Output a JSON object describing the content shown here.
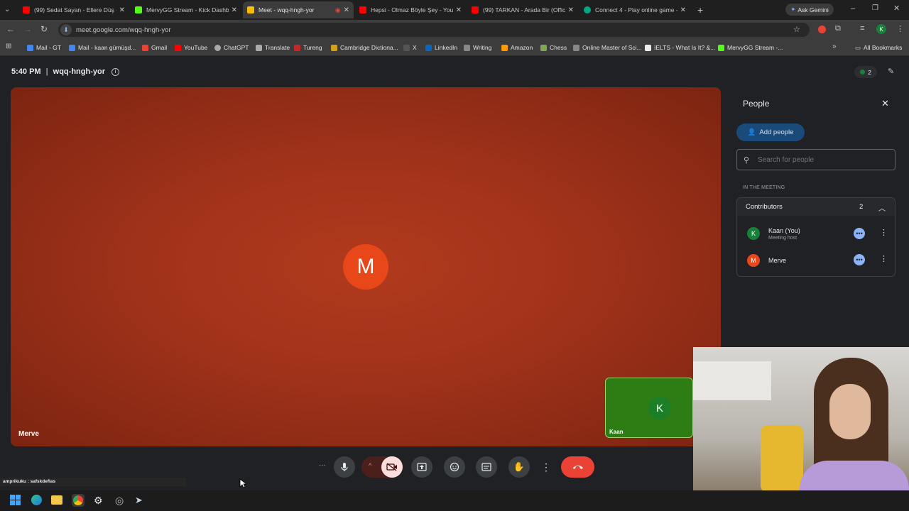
{
  "tabs": [
    {
      "title": "(99) Sedat Sayan - Ellere Düş - Y",
      "color": "#ff0000"
    },
    {
      "title": "MervyGG Stream - Kick Dashbo",
      "color": "#53fc18"
    },
    {
      "title": "Meet - wqq-hngh-yor",
      "color": "#fbbc04"
    },
    {
      "title": "Hepsi - Olmaz Böyle Şey - YouT",
      "color": "#ff0000"
    },
    {
      "title": "(99) TARKAN - Arada Bir (Offici",
      "color": "#ff0000"
    },
    {
      "title": "Connect 4 - Play online game -",
      "color": "#00a884"
    }
  ],
  "ask_gemini": "Ask Gemini",
  "url": "meet.google.com/wqq-hngh-yor",
  "bookmarks": [
    "Mail - GT",
    "Mail - kaan gümüşd...",
    "Gmail",
    "YouTube",
    "ChatGPT",
    "Translate",
    "Tureng",
    "Cambridge Dictiona...",
    "X",
    "LinkedIn",
    "Writing",
    "Amazon",
    "Chess",
    "Online Master of Sci...",
    "IELTS - What Is It? &...",
    "MervyGG Stream -..."
  ],
  "all_bookmarks": "All Bookmarks",
  "meeting": {
    "time": "5:40 PM",
    "code": "wqq-hngh-yor",
    "participant_count": "2",
    "main_tile": {
      "initial": "M",
      "name": "Merve"
    },
    "self_tile": {
      "initial": "K",
      "name": "Kaan"
    }
  },
  "people": {
    "title": "People",
    "add_people": "Add people",
    "search_placeholder": "Search for people",
    "section_label": "IN THE MEETING",
    "group": {
      "label": "Contributors",
      "count": "2"
    },
    "members": [
      {
        "initial": "K",
        "name": "Kaan (You)",
        "role": "Meeting host",
        "color": "#188038"
      },
      {
        "initial": "M",
        "name": "Merve",
        "role": "",
        "color": "#e8471a"
      }
    ]
  },
  "status_text": "amprikuku : safskdeflas",
  "colors": {
    "accent": "#8ab4f8",
    "end_call": "#ea4335",
    "stage": "#a0321a"
  }
}
